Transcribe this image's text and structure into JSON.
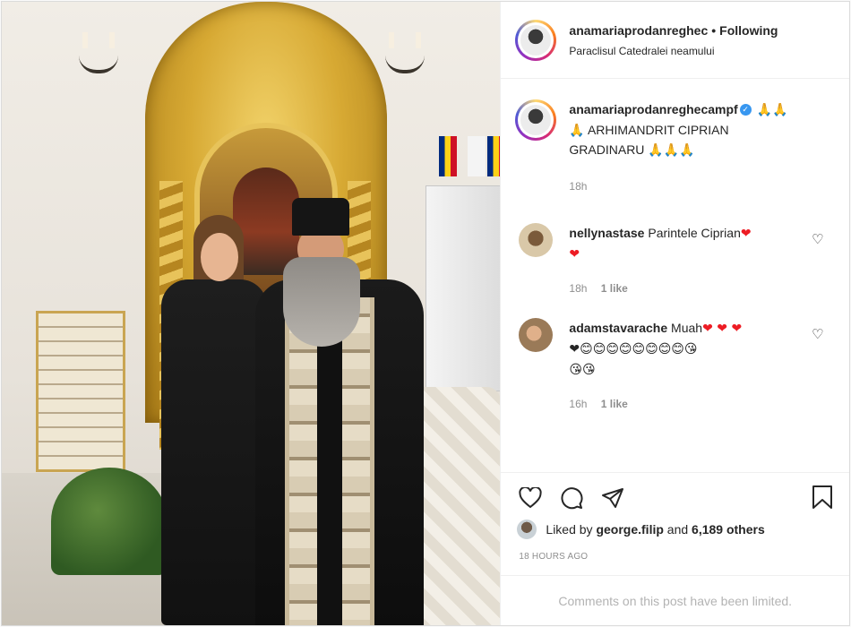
{
  "post": {
    "header": {
      "username": "anamariaprodanreghec",
      "separator": "•",
      "follow_status": "Following",
      "location": "Paraclisul Catedralei neamului"
    },
    "caption": {
      "username": "anamariaprodanreghecampf",
      "verified_icon": "✓",
      "emoji_after_name": "🙏🙏",
      "line1": "🙏 ARHIMANDRIT CIPRIAN",
      "line2": "GRADINARU",
      "emoji_after_text": "🙏🙏🙏",
      "time": "18h"
    },
    "comments": [
      {
        "username": "nellynastase",
        "text": "Parintele Ciprian",
        "hearts": "❤",
        "second_line": "❤",
        "time": "18h",
        "likes": "1 like",
        "avatar_color": "#d9c8a8"
      },
      {
        "username": "adamstavarache",
        "text": "Muah",
        "hearts": "❤ ❤ ❤",
        "second_line": "❤😊😊😊😊😊😊😊😊😘",
        "third_line": "😘😘",
        "time": "16h",
        "likes": "1 like",
        "avatar_color": "#9a7a58"
      }
    ],
    "actions": {
      "like_icon": "heart-outline-icon",
      "comment_icon": "comment-icon",
      "share_icon": "share-icon",
      "save_icon": "bookmark-icon"
    },
    "likes": {
      "prefix": "Liked by",
      "user": "george.filip",
      "conjunction": "and",
      "others": "6,189 others"
    },
    "time_ago": "18 HOURS AGO",
    "comments_notice": "Comments on this post have been limited.",
    "colors": {
      "verified": "#3897f0",
      "heart_red": "#ed1c24",
      "muted": "#8e8e8e",
      "border": "#efefef"
    }
  }
}
